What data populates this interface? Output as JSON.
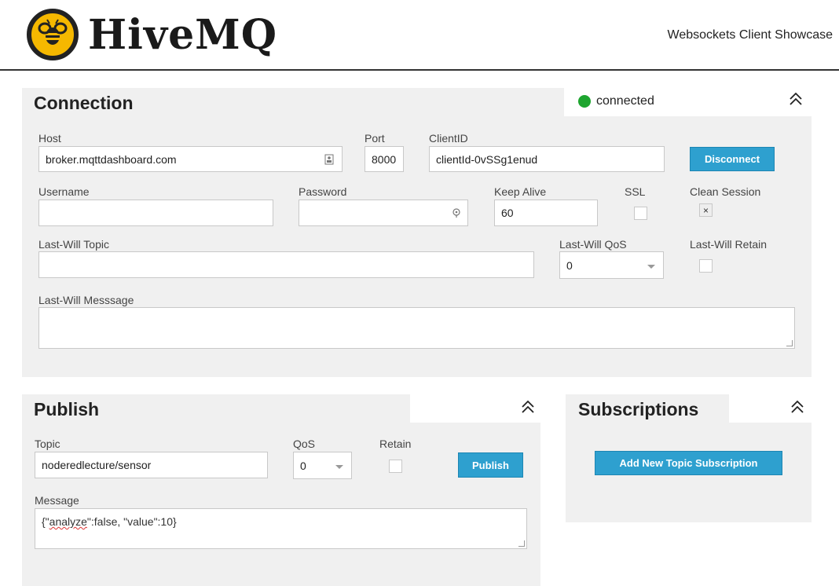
{
  "header": {
    "logo_text": "HiveMQ",
    "subtitle": "Websockets Client Showcase"
  },
  "connection": {
    "title": "Connection",
    "status": "connected",
    "status_color": "#1ea52f",
    "collapse_icon": "double-chevron-up-icon",
    "host_label": "Host",
    "host_value": "broker.mqttdashboard.com",
    "port_label": "Port",
    "port_value": "8000",
    "clientid_label": "ClientID",
    "clientid_value": "clientId-0vSSg1enud",
    "disconnect_label": "Disconnect",
    "username_label": "Username",
    "username_value": "",
    "password_label": "Password",
    "password_value": "",
    "keepalive_label": "Keep Alive",
    "keepalive_value": "60",
    "ssl_label": "SSL",
    "ssl_checked": false,
    "clean_session_label": "Clean Session",
    "clean_session_checked": true,
    "clean_session_mark": "×",
    "lw_topic_label": "Last-Will Topic",
    "lw_topic_value": "",
    "lw_qos_label": "Last-Will QoS",
    "lw_qos_value": "0",
    "lw_retain_label": "Last-Will Retain",
    "lw_message_label": "Last-Will Messsage",
    "lw_message_value": ""
  },
  "publish": {
    "title": "Publish",
    "collapse_icon": "double-chevron-up-icon",
    "topic_label": "Topic",
    "topic_value": "noderedlecture/sensor",
    "qos_label": "QoS",
    "qos_value": "0",
    "retain_label": "Retain",
    "publish_label": "Publish",
    "message_label": "Message",
    "message_prefix": "{\"",
    "message_misspelled": "analyze",
    "message_suffix": "\":false, \"value\":10}"
  },
  "subscriptions": {
    "title": "Subscriptions",
    "collapse_icon": "double-chevron-up-icon",
    "add_label": "Add New Topic Subscription"
  },
  "accent_color": "#2ea0cf"
}
